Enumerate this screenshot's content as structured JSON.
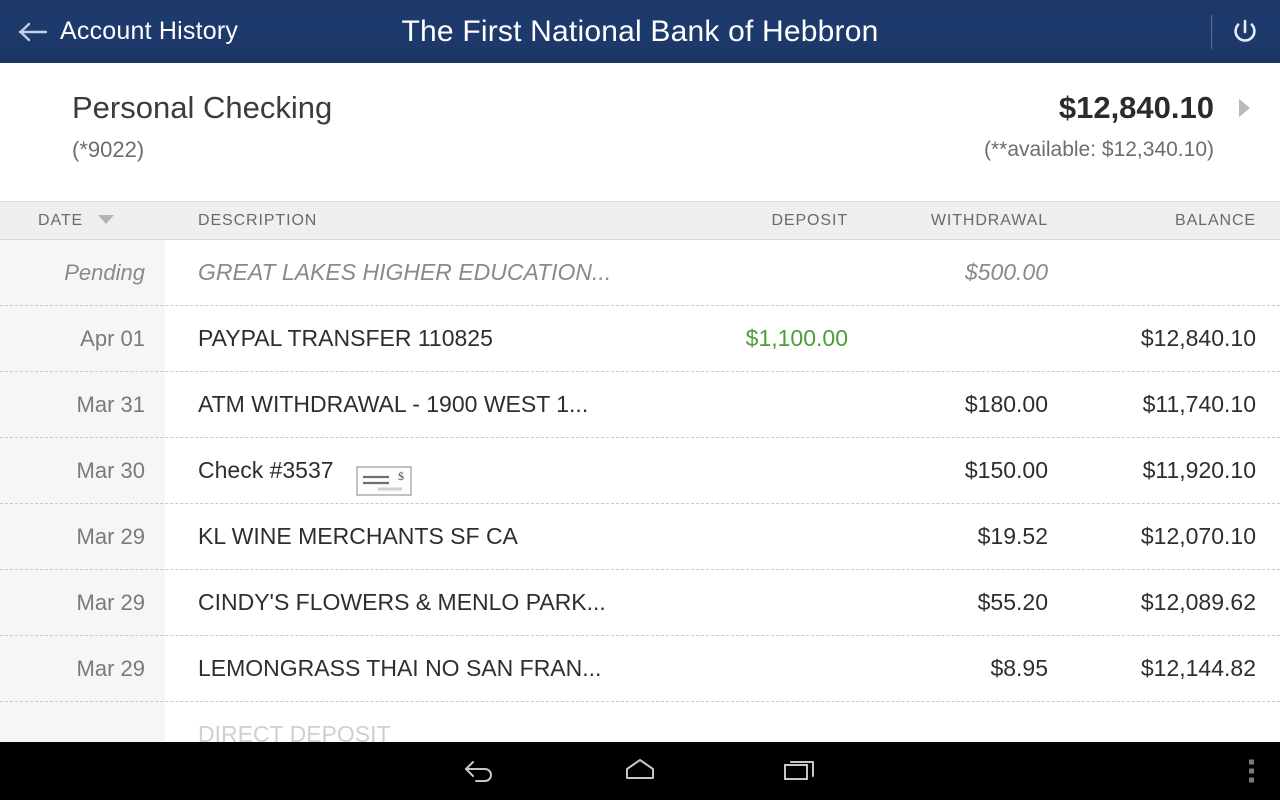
{
  "actionbar": {
    "up_label": "Account History",
    "title": "The First National Bank of Hebbron",
    "back_icon": "back-arrow-icon",
    "power_icon": "power-icon"
  },
  "summary": {
    "account_name": "Personal Checking",
    "account_number": "(*9022)",
    "balance": "$12,840.10",
    "available": "(**available: $12,340.10)",
    "chevron_icon": "chevron-right-icon"
  },
  "table": {
    "headers": {
      "date": "DATE",
      "description": "DESCRIPTION",
      "deposit": "DEPOSIT",
      "withdrawal": "WITHDRAWAL",
      "balance": "BALANCE"
    },
    "sort": {
      "column": "DATE",
      "icon": "sort-descending-icon"
    },
    "rows": [
      {
        "date": "Pending",
        "description": "GREAT LAKES HIGHER EDUCATION...",
        "deposit": "",
        "withdrawal": "$500.00",
        "balance": "",
        "pending": true
      },
      {
        "date": "Apr 01",
        "description": "PAYPAL TRANSFER 110825",
        "deposit": "$1,100.00",
        "withdrawal": "",
        "balance": "$12,840.10",
        "pending": false
      },
      {
        "date": "Mar 31",
        "description": "ATM WITHDRAWAL - 1900 WEST 1...",
        "deposit": "",
        "withdrawal": "$180.00",
        "balance": "$11,740.10",
        "pending": false
      },
      {
        "date": "Mar 30",
        "description": "Check #3537",
        "deposit": "",
        "withdrawal": "$150.00",
        "balance": "$11,920.10",
        "pending": false,
        "check_image_icon": "check-image-icon"
      },
      {
        "date": "Mar 29",
        "description": "KL WINE MERCHANTS SF CA",
        "deposit": "",
        "withdrawal": "$19.52",
        "balance": "$12,070.10",
        "pending": false
      },
      {
        "date": "Mar 29",
        "description": "CINDY'S FLOWERS & MENLO PARK...",
        "deposit": "",
        "withdrawal": "$55.20",
        "balance": "$12,089.62",
        "pending": false
      },
      {
        "date": "Mar 29",
        "description": "LEMONGRASS THAI NO SAN FRAN...",
        "deposit": "",
        "withdrawal": "$8.95",
        "balance": "$12,144.82",
        "pending": false
      },
      {
        "date": "",
        "description": "DIRECT DEPOSIT",
        "deposit": "",
        "withdrawal": "",
        "balance": "",
        "pending": false,
        "clipped": true
      }
    ]
  },
  "navbar": {
    "back_icon": "nav-back-icon",
    "home_icon": "nav-home-icon",
    "recents_icon": "nav-recents-icon",
    "overflow_icon": "overflow-menu-icon"
  },
  "colors": {
    "actionbar": "#1e3a6d",
    "deposit_green": "#4c9e37",
    "header_band": "#efefef",
    "date_band": "#f6f6f6"
  }
}
